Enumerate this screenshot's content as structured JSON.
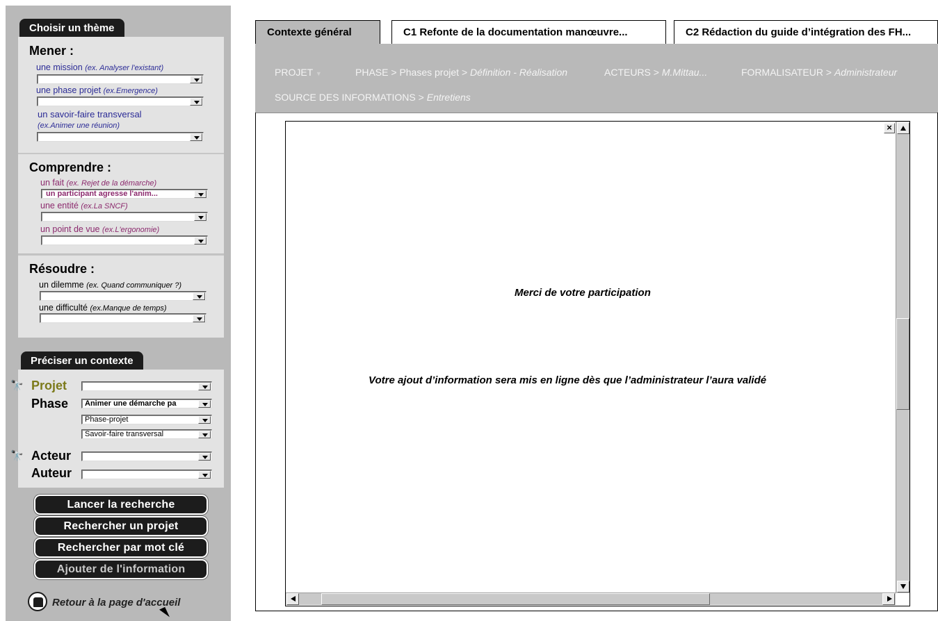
{
  "sidebar": {
    "themes_tab": "Choisir un thème",
    "mener": {
      "title": "Mener :",
      "mission_label": "une mission",
      "mission_example": "(ex. Analyser l'existant)",
      "phase_label": "une phase projet",
      "phase_example": "(ex.Emergence)",
      "savoir_label": "un savoir-faire transversal",
      "savoir_example": "(ex.Animer une réunion)"
    },
    "comprendre": {
      "title": "Comprendre :",
      "fait_label": "un  fait",
      "fait_example": "(ex. Rejet de la démarche)",
      "fait_value": "un participant agresse l'anim...",
      "entite_label": "une entité",
      "entite_example": "(ex.La SNCF)",
      "pdv_label": "un point de vue",
      "pdv_example": "(ex.L'ergonomie)"
    },
    "resoudre": {
      "title": "Résoudre :",
      "dilemme_label": "un  dilemme",
      "dilemme_example": "(ex. Quand communiquer ?)",
      "difficulte_label": "une difficulté",
      "difficulte_example": "(ex.Manque de temps)"
    },
    "context_tab": "Préciser un contexte",
    "context": {
      "projet_label": "Projet",
      "phase_label": "Phase",
      "phase_value": "Animer une démarche pa",
      "phase_sub1": "Phase-projet",
      "phase_sub2": "Savoir-faire transversal",
      "acteur_label": "Acteur",
      "auteur_label": "Auteur"
    },
    "buttons": {
      "search": "Lancer la recherche",
      "search_project": "Rechercher un projet",
      "search_keyword": "Rechercher par mot clé",
      "add_info": "Ajouter de l'information"
    },
    "home_link": "Retour à la page d'accueil"
  },
  "tabs": [
    {
      "label": "Contexte général"
    },
    {
      "label": "C1 Refonte de la documentation manœuvre..."
    },
    {
      "label": "C2 Rédaction du guide d’intégration des FH..."
    }
  ],
  "context_bar": {
    "projet": "PROJET",
    "phase_key": "PHASE",
    "phase_mid": "Phases projet",
    "phase_val": "Définition - Réalisation",
    "acteurs_key": "ACTEURS",
    "acteurs_val": "M.Mittau...",
    "formalisateur_key": "FORMALISATEUR",
    "formalisateur_val": "Administrateur",
    "source_key": "SOURCE DES INFORMATIONS",
    "source_val": "Entretiens",
    "sep": ">"
  },
  "content": {
    "thanks": "Merci de votre participation",
    "notice": "Votre ajout d’information sera mis en ligne dès que l’administrateur l’aura validé"
  },
  "colors": {
    "sidebar_bg": "#b9b9b9",
    "panel_bg": "#e3e3e3",
    "dark": "#1c1c1c",
    "label_blue": "#2b2b96",
    "label_magenta": "#8c2a6e",
    "projet_olive": "#7c7a1a"
  }
}
